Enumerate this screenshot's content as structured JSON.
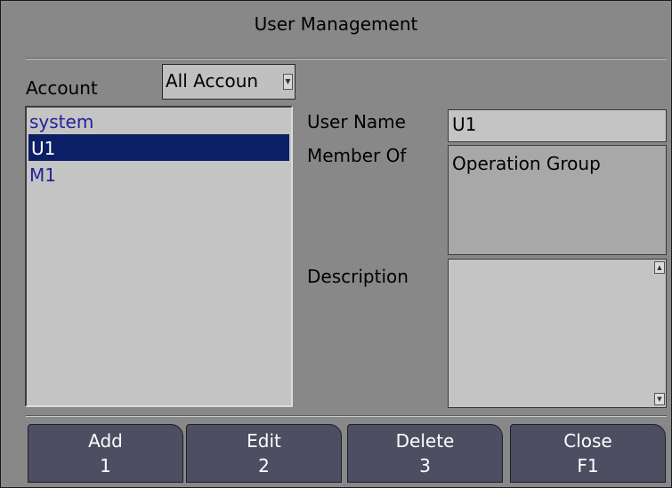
{
  "dialog": {
    "title": "User Management"
  },
  "account": {
    "label": "Account",
    "filter_value": "All Accoun",
    "users": [
      "system",
      "U1",
      "M1"
    ],
    "selected_index": 1
  },
  "details": {
    "user_name_label": "User Name",
    "user_name_value": "U1",
    "member_of_label": "Member Of",
    "member_of_value": "Operation Group",
    "description_label": "Description",
    "description_value": ""
  },
  "buttons": [
    {
      "label": "Add",
      "key": "1"
    },
    {
      "label": "Edit",
      "key": "2"
    },
    {
      "label": "Delete",
      "key": "3"
    },
    {
      "label": "Close",
      "key": "F1"
    }
  ],
  "icons": {
    "dropdown": "chevron-down-icon",
    "scroll_up": "arrow-up-icon",
    "scroll_down": "arrow-down-icon"
  }
}
